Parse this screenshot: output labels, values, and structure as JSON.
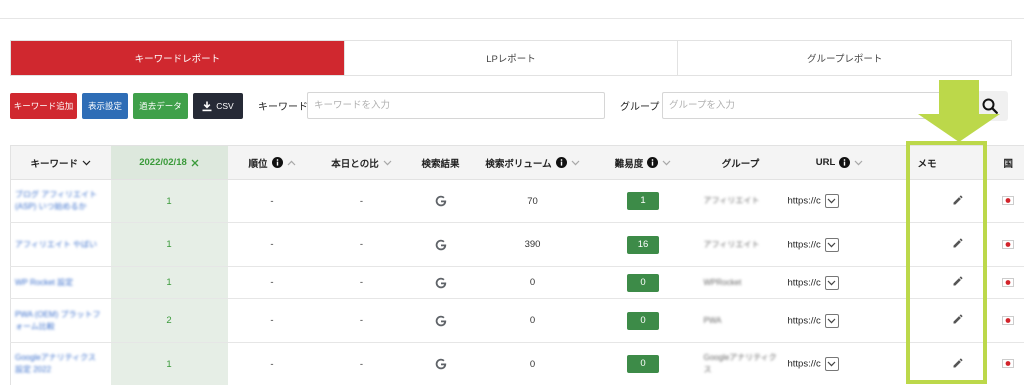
{
  "colors": {
    "primary_red": "#d0282f",
    "display_blue": "#2e6db6",
    "past_data_green": "#3fa04a",
    "csv_dark": "#262a36",
    "date_column_bg": "#e6eee6",
    "date_text_green": "#3a9a3a",
    "difficulty_badge_green": "#3d8b48",
    "keyword_link_blue": "#3a6fcc",
    "annotation_green": "#bcd84a"
  },
  "tabs": [
    {
      "label": "キーワードレポート",
      "active": true
    },
    {
      "label": "LPレポート",
      "active": false
    },
    {
      "label": "グループレポート",
      "active": false
    }
  ],
  "toolbar": {
    "add_keyword_label": "キーワード追加",
    "display_settings_label": "表示設定",
    "past_data_label": "過去データ",
    "csv_label": "CSV",
    "csv_icon": "download-icon",
    "keyword_filter_label": "キーワード",
    "keyword_placeholder": "キーワードを入力",
    "group_filter_label": "グループ",
    "group_placeholder": "グループを入力",
    "search_icon": "search-icon"
  },
  "table": {
    "columns": [
      {
        "key": "keyword",
        "label": "キーワード",
        "icons": [
          "chevron-down-icon"
        ]
      },
      {
        "key": "date",
        "label": "2022/02/18",
        "icons": [
          "close-icon"
        ]
      },
      {
        "key": "rank",
        "label": "順位",
        "icons": [
          "info-icon",
          "chevron-up-icon"
        ]
      },
      {
        "key": "change",
        "label": "本日との比",
        "icons": [
          "chevron-down-icon"
        ]
      },
      {
        "key": "serp",
        "label": "検索結果",
        "icons": []
      },
      {
        "key": "volume",
        "label": "検索ボリューム",
        "icons": [
          "info-icon",
          "chevron-down-icon"
        ]
      },
      {
        "key": "difficulty",
        "label": "難易度",
        "icons": [
          "info-icon",
          "chevron-down-icon"
        ]
      },
      {
        "key": "group",
        "label": "グループ",
        "icons": []
      },
      {
        "key": "url",
        "label": "URL",
        "icons": [
          "info-icon",
          "chevron-down-icon"
        ]
      },
      {
        "key": "memo",
        "label": "メモ",
        "icons": []
      },
      {
        "key": "country",
        "label": "国",
        "icons": []
      }
    ],
    "rows": [
      {
        "keyword": "ブログ アフィリエイト(ASP) いつ始めるか",
        "rank_on_date": "1",
        "rank": "-",
        "change": "-",
        "search_result_icon": "google-icon",
        "search_volume": "70",
        "difficulty": "1",
        "group": "アフィリエイト",
        "url": "https://c",
        "memo_icon": "pencil-icon",
        "country_icon": "japan-flag-icon"
      },
      {
        "keyword": "アフィリエイト やばい",
        "rank_on_date": "1",
        "rank": "-",
        "change": "-",
        "search_result_icon": "google-icon",
        "search_volume": "390",
        "difficulty": "16",
        "group": "アフィリエイト",
        "url": "https://c",
        "memo_icon": "pencil-icon",
        "country_icon": "japan-flag-icon"
      },
      {
        "keyword": "WP Rocket 設定",
        "rank_on_date": "1",
        "rank": "-",
        "change": "-",
        "search_result_icon": "google-icon",
        "search_volume": "0",
        "difficulty": "0",
        "group": "WPRocket",
        "url": "https://c",
        "memo_icon": "pencil-icon",
        "country_icon": "japan-flag-icon"
      },
      {
        "keyword": "PWA (OEM) プラットフォーム比較",
        "rank_on_date": "2",
        "rank": "-",
        "change": "-",
        "search_result_icon": "google-icon",
        "search_volume": "0",
        "difficulty": "0",
        "group": "PWA",
        "url": "https://c",
        "memo_icon": "pencil-icon",
        "country_icon": "japan-flag-icon"
      },
      {
        "keyword": "Googleアナリティクス 設定 2022",
        "rank_on_date": "1",
        "rank": "-",
        "change": "-",
        "search_result_icon": "google-icon",
        "search_volume": "0",
        "difficulty": "0",
        "group": "Googleアナリティクス",
        "url": "https://c",
        "memo_icon": "pencil-icon",
        "country_icon": "japan-flag-icon"
      }
    ]
  }
}
